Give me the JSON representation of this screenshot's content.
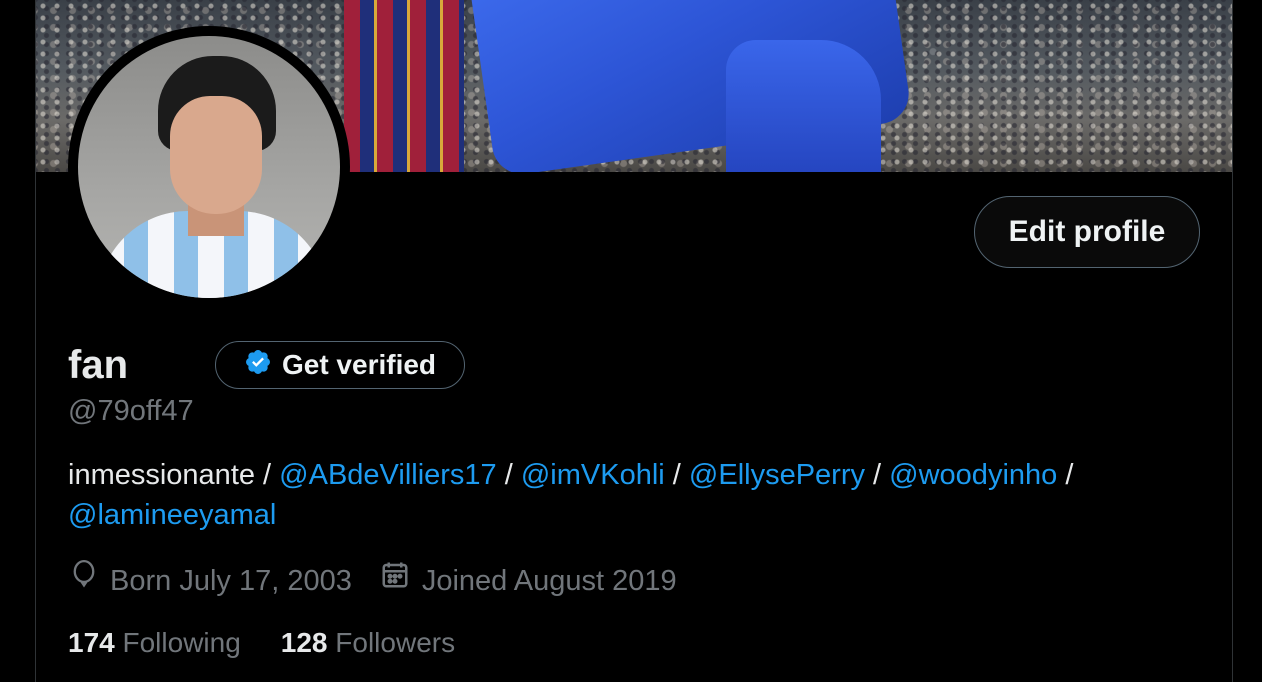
{
  "profile": {
    "display_name": "fan",
    "handle": "@79off47",
    "edit_profile_label": "Edit profile",
    "get_verified_label": "Get verified",
    "bio": {
      "text_before": "inmessionante / ",
      "mentions": [
        "@ABdeVilliers17",
        "@imVKohli",
        "@EllysePerry",
        "@woodyinho",
        "@lamineeyamal"
      ],
      "separator": " / "
    },
    "birthday": "Born July 17, 2003",
    "joined": "Joined August 2019",
    "following_count": "174",
    "following_label": "Following",
    "followers_count": "128",
    "followers_label": "Followers"
  },
  "colors": {
    "accent": "#1d9bf0",
    "muted": "#71767b",
    "text": "#e7e9ea",
    "border": "#536471",
    "background": "#000000"
  },
  "icons": {
    "verified": "verified-badge-icon",
    "birthday": "balloon-icon",
    "joined": "calendar-icon"
  }
}
